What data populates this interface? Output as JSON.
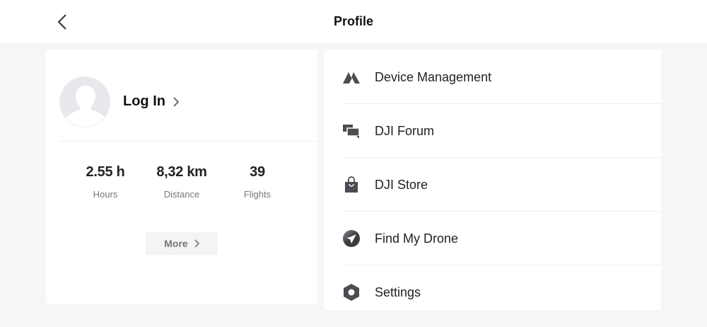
{
  "header": {
    "title": "Profile",
    "back_icon": "chevron-left-icon"
  },
  "profile": {
    "login_label": "Log In",
    "stats": [
      {
        "value": "2.55 h",
        "label": "Hours"
      },
      {
        "value": "8,32 km",
        "label": "Distance"
      },
      {
        "value": "39",
        "label": "Flights"
      }
    ],
    "more_label": "More"
  },
  "menu": [
    {
      "label": "Device Management",
      "icon": "device-icon"
    },
    {
      "label": "DJI Forum",
      "icon": "forum-icon"
    },
    {
      "label": "DJI Store",
      "icon": "store-bag-icon"
    },
    {
      "label": "Find My Drone",
      "icon": "compass-icon"
    },
    {
      "label": "Settings",
      "icon": "hexagon-settings-icon"
    }
  ],
  "colors": {
    "background": "#f5f6f8",
    "card": "#ffffff",
    "icon": "#4a4d52"
  }
}
